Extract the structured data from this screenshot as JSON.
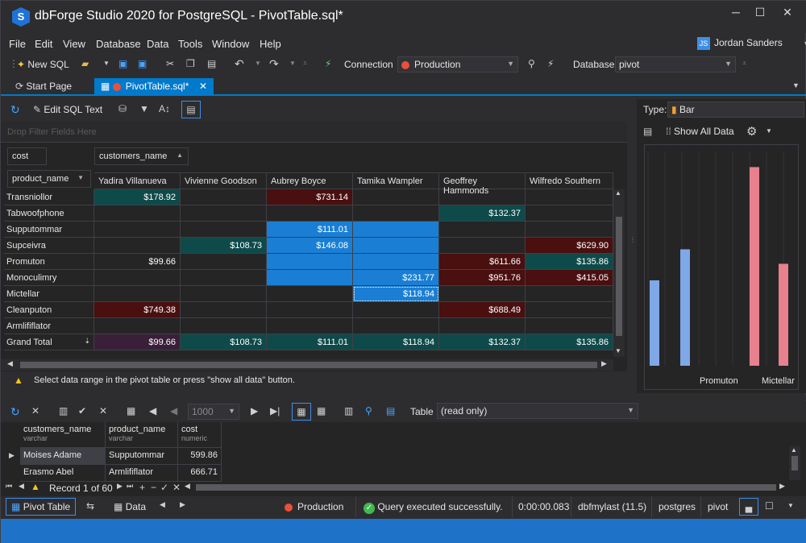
{
  "window": {
    "title": "dbForge Studio 2020 for PostgreSQL - PivotTable.sql*",
    "logo": "S"
  },
  "menu": [
    "File",
    "Edit",
    "View",
    "Database",
    "Data",
    "Tools",
    "Window",
    "Help"
  ],
  "user": {
    "initials": "JS",
    "name": "Jordan Sanders"
  },
  "toolbar": {
    "new_sql": "New SQL",
    "connection_label": "Connection",
    "connection_value": "Production",
    "database_label": "Database",
    "database_value": "pivot"
  },
  "tabs": [
    {
      "label": "Start Page"
    },
    {
      "label": "PivotTable.sql*"
    }
  ],
  "pivot": {
    "edit_sql": "Edit SQL Text",
    "filter_placeholder": "Drop Filter Fields Here",
    "data_field": "cost",
    "column_field": "customers_name",
    "row_field": "product_name",
    "columns": [
      "Yadira Villanueva",
      "Vivienne Goodson",
      "Aubrey Boyce",
      "Tamika Wampler",
      "Geoffrey Hammonds",
      "Wilfredo Southern"
    ],
    "rows": [
      {
        "name": "Transniollor",
        "values": [
          "$178.92",
          "",
          "$731.14",
          "",
          "",
          ""
        ]
      },
      {
        "name": "Tabwoofphone",
        "values": [
          "",
          "",
          "",
          "",
          "$132.37",
          ""
        ]
      },
      {
        "name": "Supputommar",
        "values": [
          "",
          "",
          "$111.01",
          "",
          "",
          ""
        ]
      },
      {
        "name": "Supceivra",
        "values": [
          "",
          "$108.73",
          "$146.08",
          "",
          "",
          "$629.90"
        ]
      },
      {
        "name": "Promuton",
        "values": [
          "$99.66",
          "",
          "",
          "",
          "$611.66",
          "$135.86"
        ]
      },
      {
        "name": "Monoculimry",
        "values": [
          "",
          "",
          "",
          "$231.77",
          "$951.76",
          "$415.05"
        ]
      },
      {
        "name": "Mictellar",
        "values": [
          "",
          "",
          "",
          "$118.94",
          "",
          ""
        ]
      },
      {
        "name": "Cleanputon",
        "values": [
          "$749.38",
          "",
          "",
          "",
          "$688.49",
          ""
        ]
      },
      {
        "name": "Armlififlator",
        "values": [
          "",
          "",
          "",
          "",
          "",
          ""
        ]
      }
    ],
    "grand_total": {
      "name": "Grand Total",
      "values": [
        "$99.66",
        "$108.73",
        "$111.01",
        "$118.94",
        "$132.37",
        "$135.86"
      ]
    },
    "hint": "Select data range in the pivot table or press \"show all data\" button."
  },
  "chart_panel": {
    "type_label": "Type:",
    "type_value": "Bar",
    "show_all": "Show All Data",
    "x_labels": [
      "Promuton",
      "Mictellar"
    ]
  },
  "chart_data": {
    "type": "bar",
    "categories": [
      "Promuton",
      "Mictellar"
    ],
    "series": [],
    "bars": [
      {
        "category": "Promuton",
        "value": 99.66,
        "color": "#7fa8e8"
      },
      {
        "category": "Promuton",
        "value": 135.86,
        "color": "#7fa8e8"
      },
      {
        "category": "Mictellar",
        "value": 231.77,
        "color": "#e8808e"
      },
      {
        "category": "Mictellar",
        "value": 118.94,
        "color": "#e8808e"
      }
    ],
    "title": "",
    "xlabel": "",
    "ylabel": "",
    "ylim": [
      0,
      250
    ],
    "grid": true
  },
  "data_grid": {
    "page_size": "1000",
    "view_label": "Table",
    "view_value": "(read only)",
    "columns": [
      {
        "name": "customers_name",
        "type": "varchar"
      },
      {
        "name": "product_name",
        "type": "varchar"
      },
      {
        "name": "cost",
        "type": "numeric"
      }
    ],
    "rows": [
      [
        "Moises Adame",
        "Supputommar",
        "599.86"
      ],
      [
        "Erasmo Abel",
        "Armlififlator",
        "666.71"
      ]
    ],
    "record": "Record 1 of 60"
  },
  "status": {
    "pivot_table": "Pivot Table",
    "data": "Data",
    "connection": "Production",
    "message": "Query executed successfully.",
    "time": "0:00:00.083",
    "server": "dbfmylast (11.5)",
    "user": "postgres",
    "database": "pivot"
  }
}
